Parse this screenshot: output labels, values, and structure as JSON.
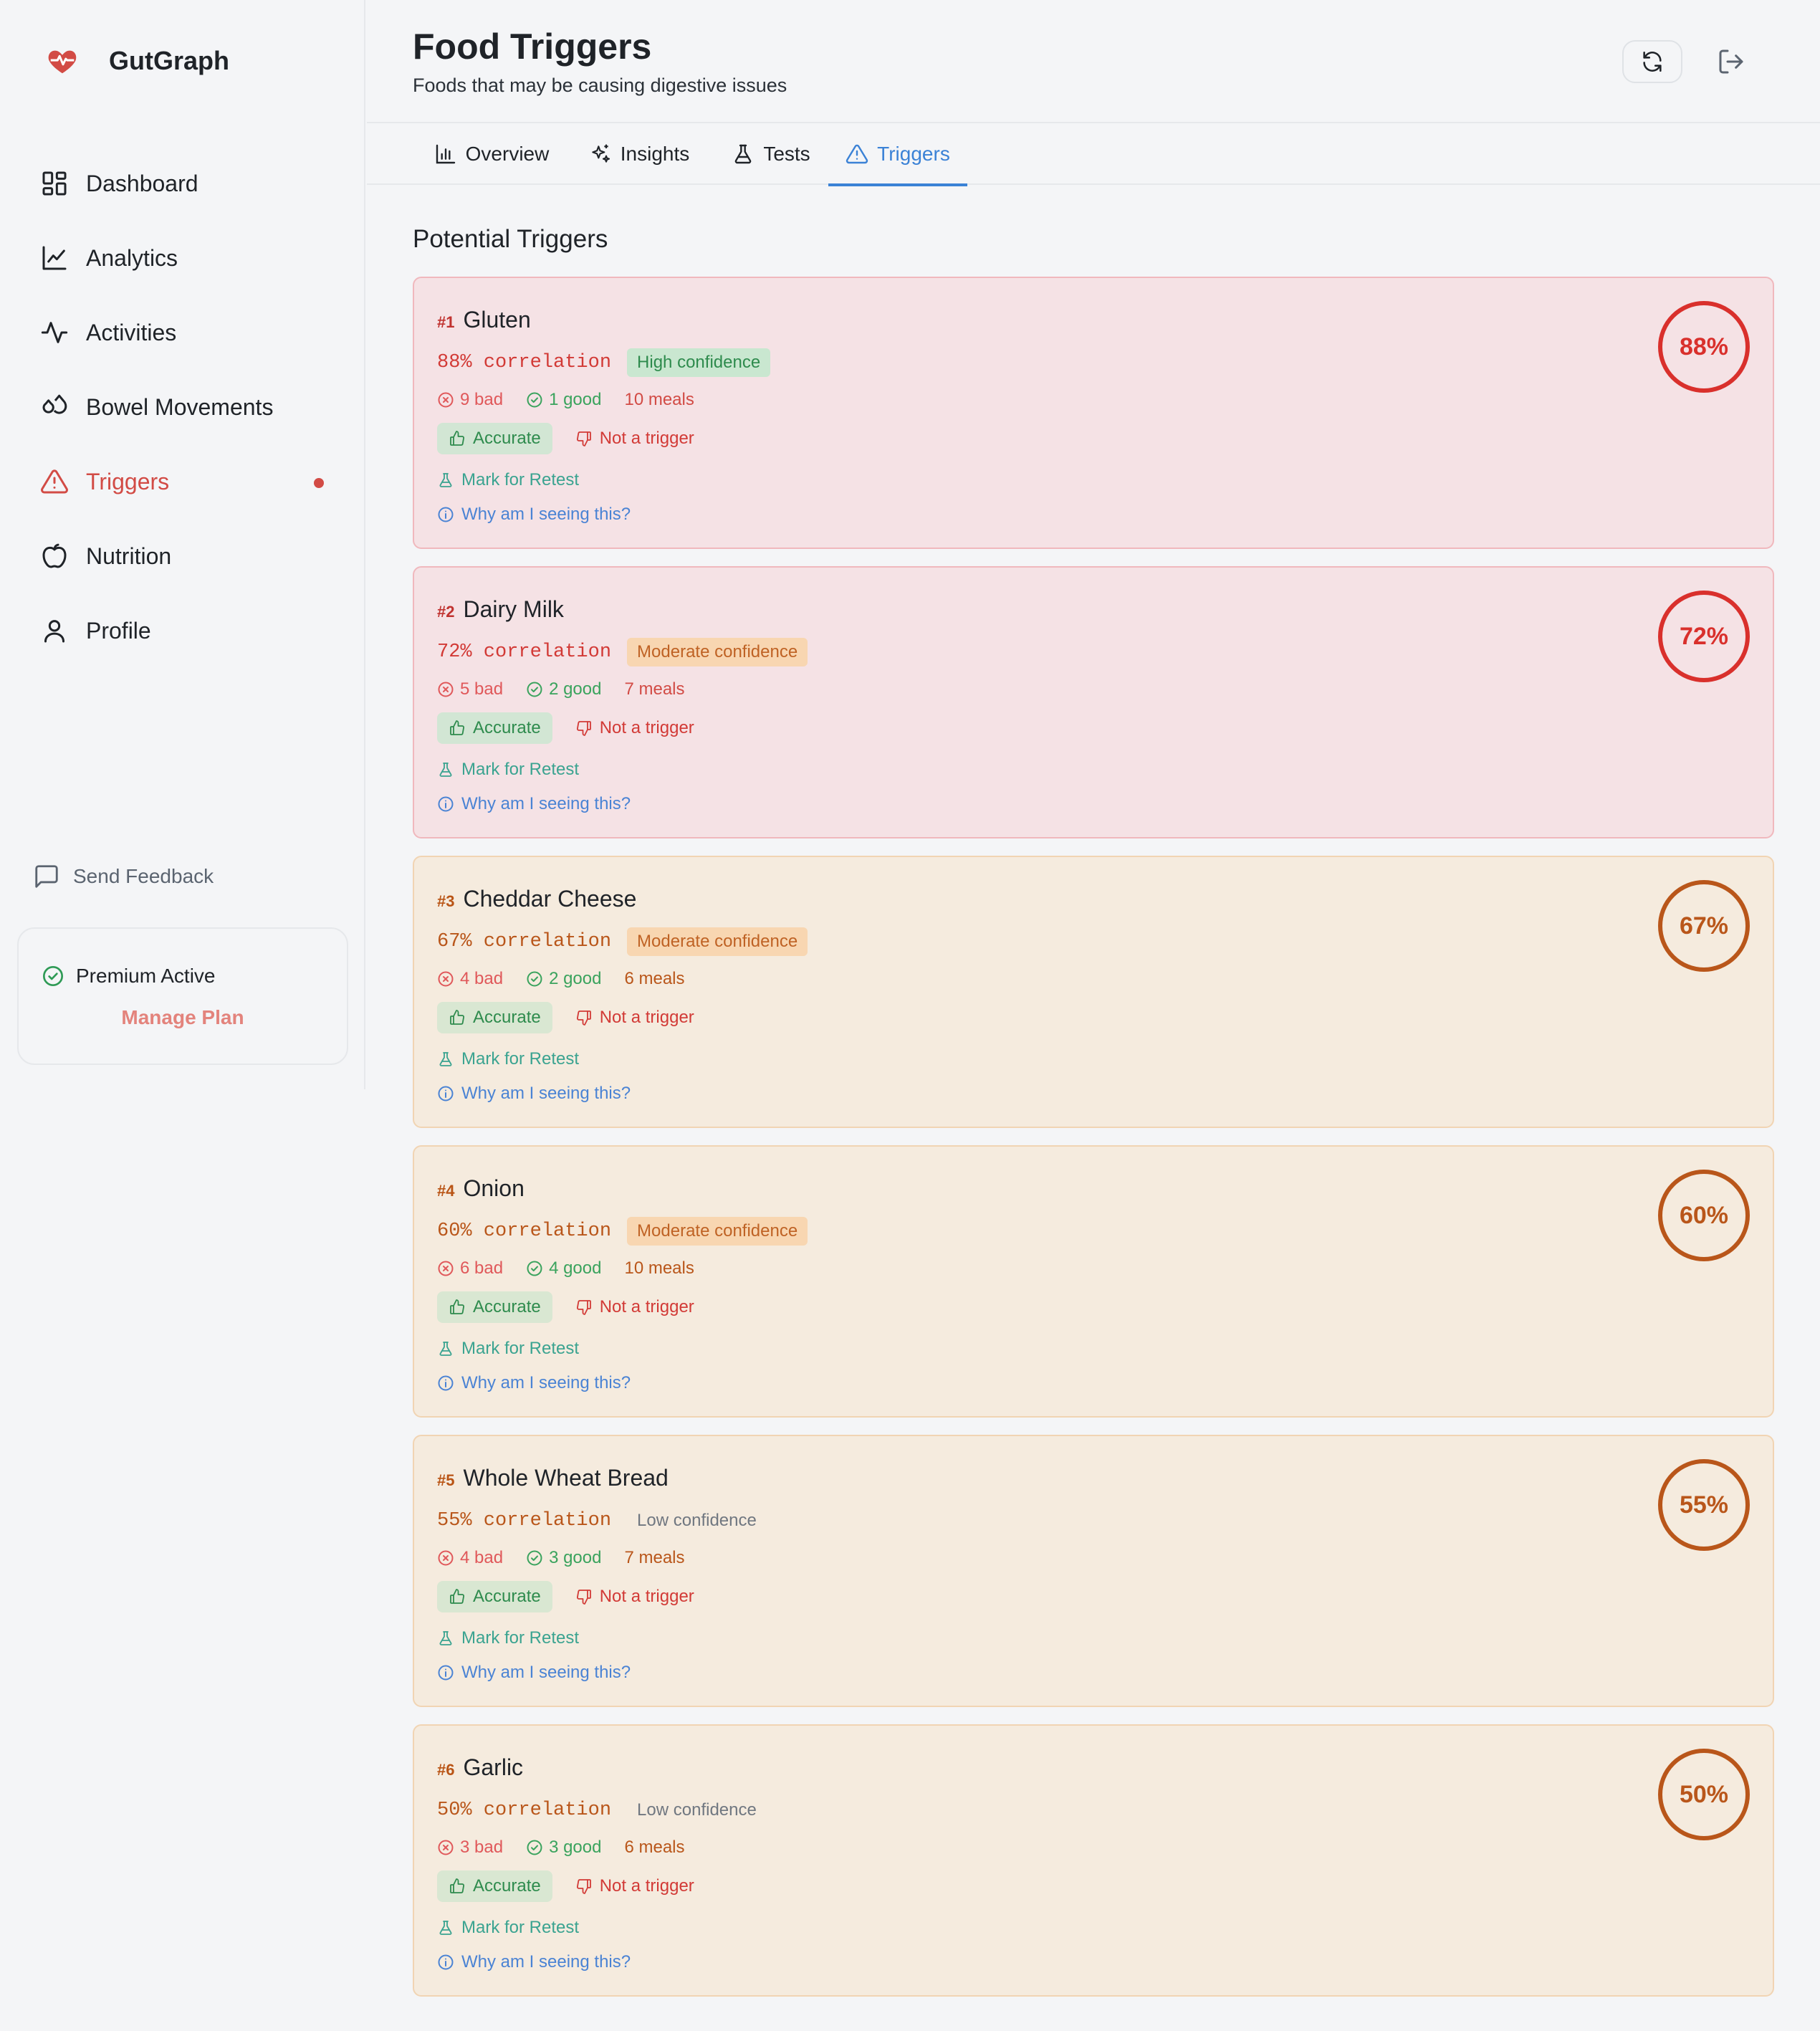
{
  "app": {
    "name": "GutGraph",
    "brand_color": "#d24b45"
  },
  "sidebar": {
    "items": [
      {
        "label": "Dashboard",
        "icon": "dashboard-icon"
      },
      {
        "label": "Analytics",
        "icon": "line-chart-icon"
      },
      {
        "label": "Activities",
        "icon": "activity-icon"
      },
      {
        "label": "Bowel Movements",
        "icon": "droplets-icon"
      },
      {
        "label": "Triggers",
        "icon": "warning-triangle-icon",
        "active": true,
        "has_dot": true
      },
      {
        "label": "Nutrition",
        "icon": "apple-icon"
      },
      {
        "label": "Profile",
        "icon": "user-icon"
      }
    ],
    "feedback_label": "Send Feedback",
    "premium": {
      "status": "Premium Active",
      "manage_label": "Manage Plan"
    }
  },
  "header": {
    "title": "Food Triggers",
    "subtitle": "Foods that may be causing digestive issues"
  },
  "tabs": [
    {
      "label": "Overview",
      "icon": "bar-chart-icon"
    },
    {
      "label": "Insights",
      "icon": "sparkles-icon"
    },
    {
      "label": "Tests",
      "icon": "flask-icon"
    },
    {
      "label": "Triggers",
      "icon": "warning-triangle-icon",
      "active": true
    }
  ],
  "section_title": "Potential Triggers",
  "labels": {
    "accurate": "Accurate",
    "not_trigger": "Not a trigger",
    "retest": "Mark for Retest",
    "why": "Why am I seeing this?"
  },
  "triggers": [
    {
      "rank": "#1",
      "name": "Gluten",
      "correlation": "88% correlation",
      "confidence": "High confidence",
      "confidence_level": "high",
      "bad": "9 bad",
      "good": "1 good",
      "meals": "10 meals",
      "percent": "88%",
      "tone": "red"
    },
    {
      "rank": "#2",
      "name": "Dairy Milk",
      "correlation": "72% correlation",
      "confidence": "Moderate confidence",
      "confidence_level": "moderate",
      "bad": "5 bad",
      "good": "2 good",
      "meals": "7 meals",
      "percent": "72%",
      "tone": "red"
    },
    {
      "rank": "#3",
      "name": "Cheddar Cheese",
      "correlation": "67% correlation",
      "confidence": "Moderate confidence",
      "confidence_level": "moderate",
      "bad": "4 bad",
      "good": "2 good",
      "meals": "6 meals",
      "percent": "67%",
      "tone": "orange"
    },
    {
      "rank": "#4",
      "name": "Onion",
      "correlation": "60% correlation",
      "confidence": "Moderate confidence",
      "confidence_level": "moderate",
      "bad": "6 bad",
      "good": "4 good",
      "meals": "10 meals",
      "percent": "60%",
      "tone": "orange"
    },
    {
      "rank": "#5",
      "name": "Whole Wheat Bread",
      "correlation": "55% correlation",
      "confidence": "Low confidence",
      "confidence_level": "low",
      "bad": "4 bad",
      "good": "3 good",
      "meals": "7 meals",
      "percent": "55%",
      "tone": "orange"
    },
    {
      "rank": "#6",
      "name": "Garlic",
      "correlation": "50% correlation",
      "confidence": "Low confidence",
      "confidence_level": "low",
      "bad": "3 bad",
      "good": "3 good",
      "meals": "6 meals",
      "percent": "50%",
      "tone": "orange"
    }
  ],
  "colors": {
    "red_tone": "#d9302c",
    "orange_tone": "#b9561a",
    "accent_blue": "#3b82d6",
    "good_green": "#3aa35d"
  }
}
